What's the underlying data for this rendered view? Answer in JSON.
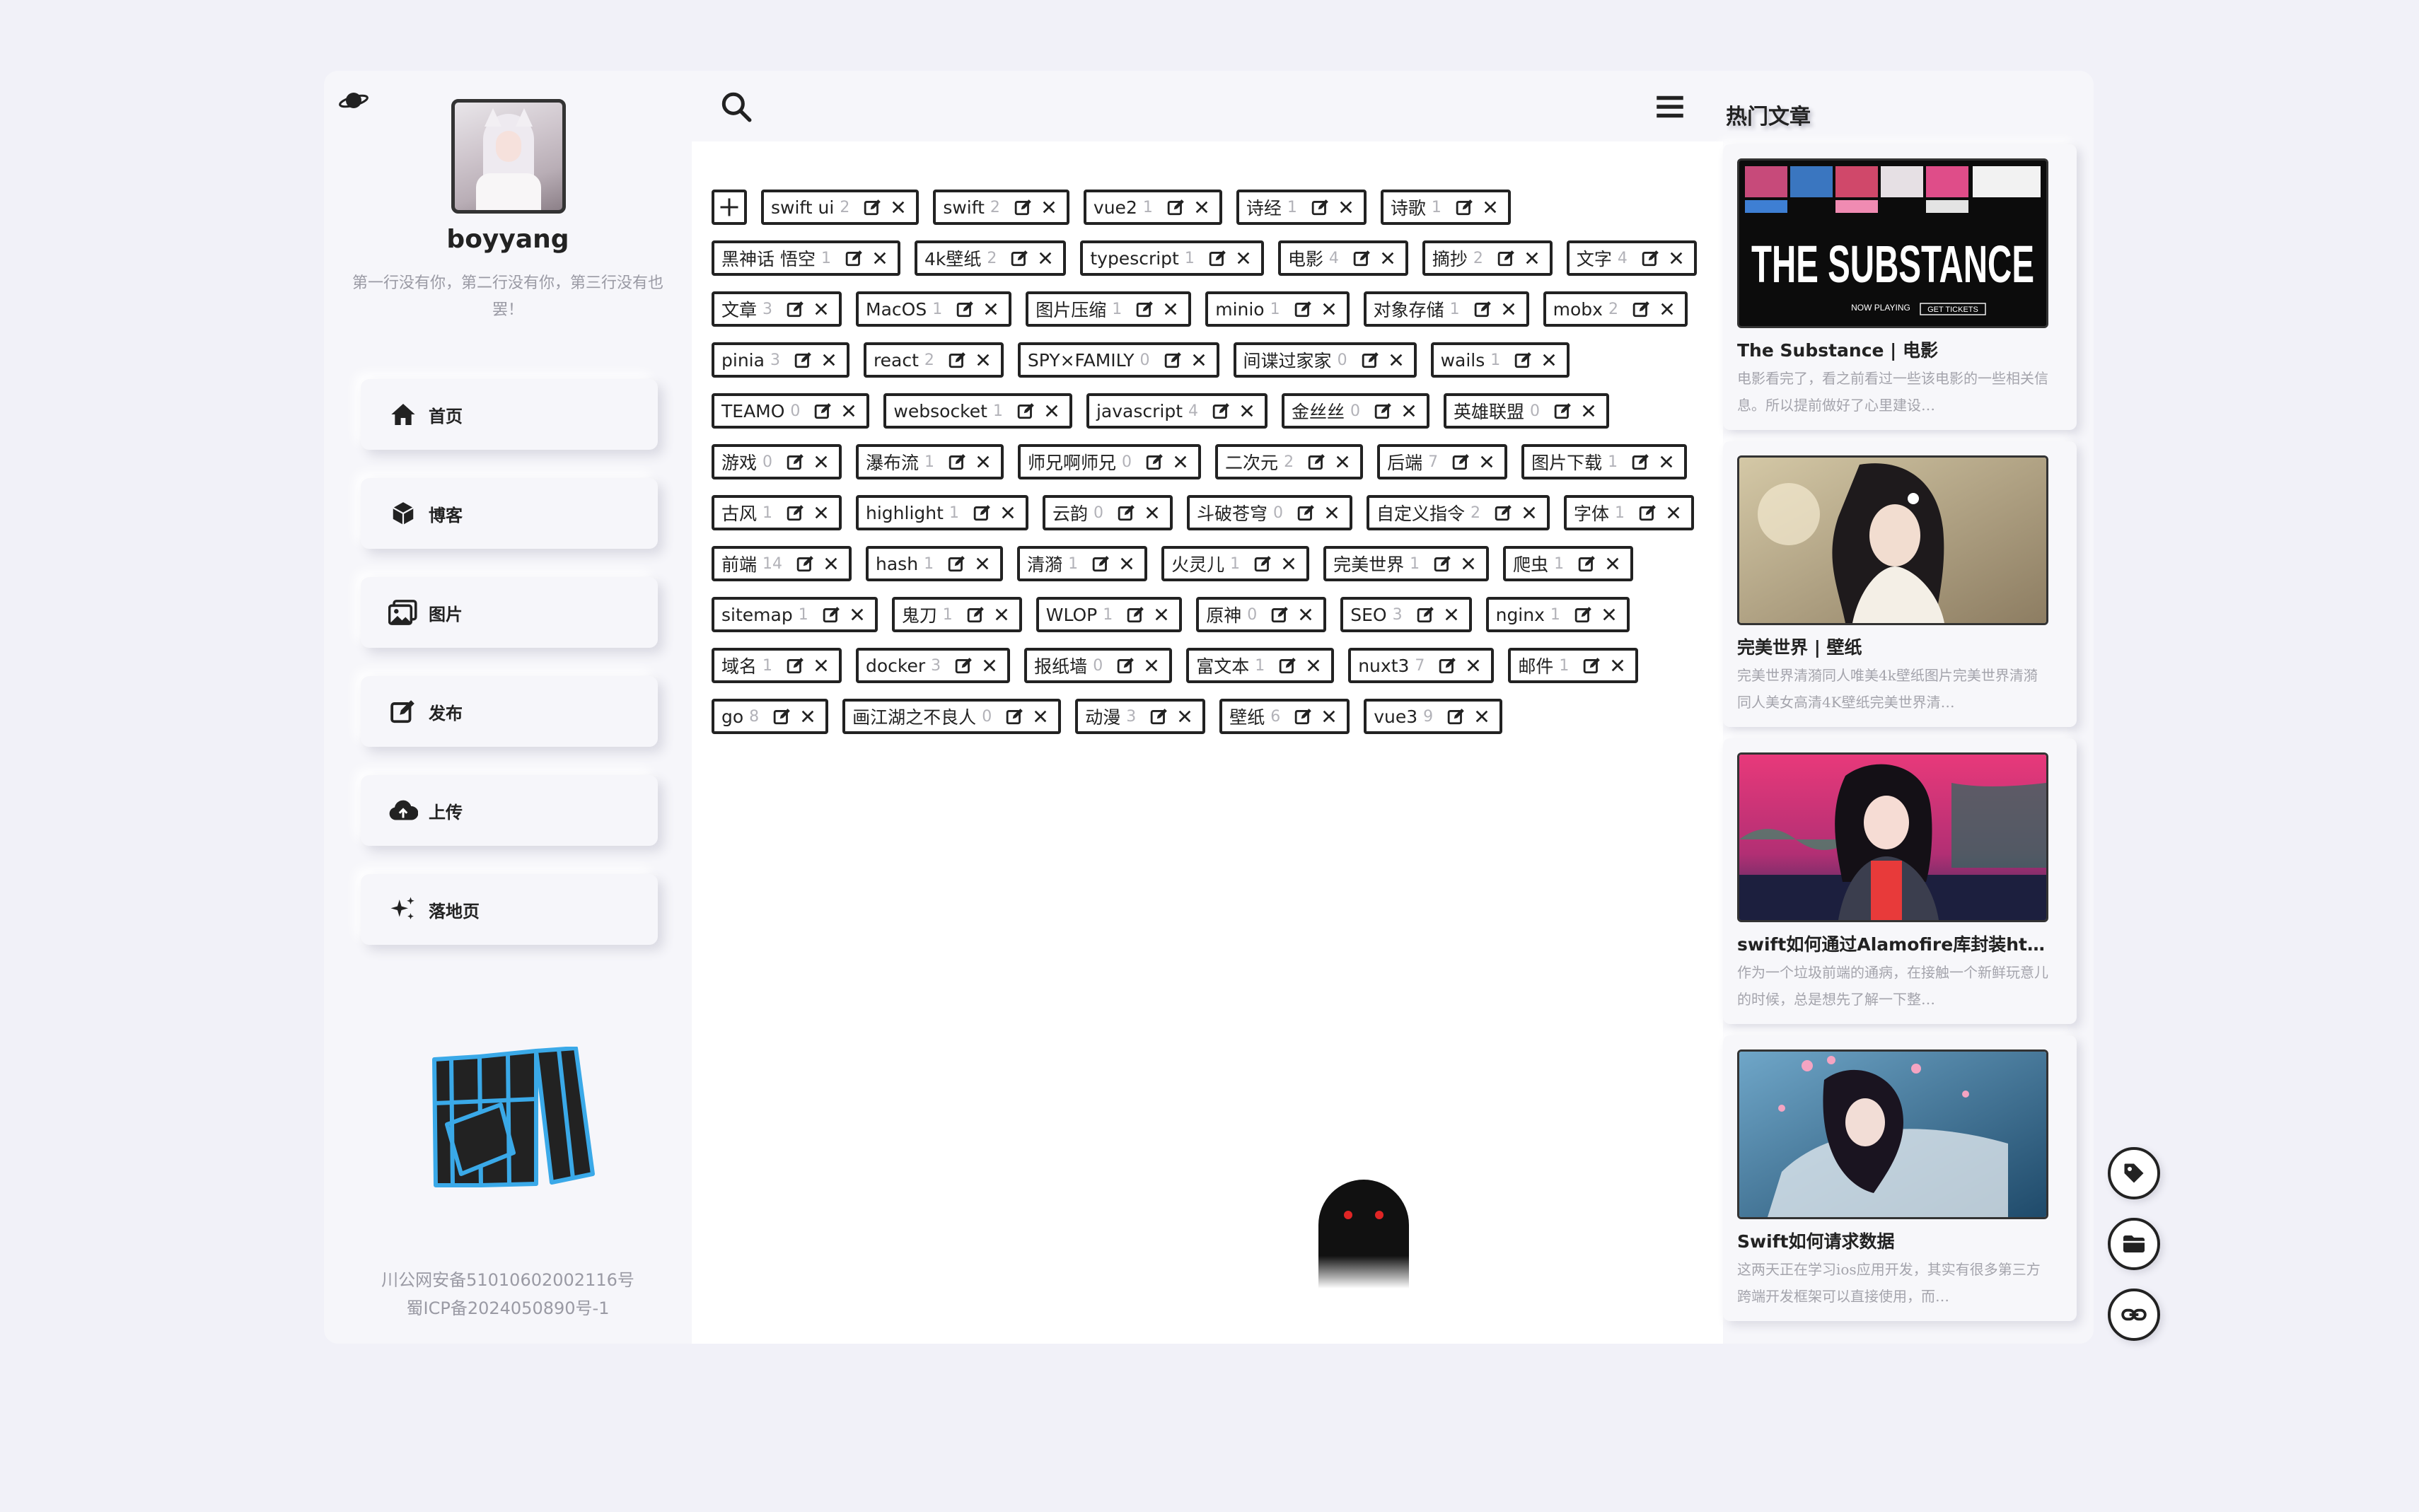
{
  "sidebar": {
    "username": "boyyang",
    "bio": "第一行没有你，第二行没有你，第三行没有也罢！",
    "nav": [
      {
        "label": "首页",
        "icon": "home-icon"
      },
      {
        "label": "博客",
        "icon": "cube-icon"
      },
      {
        "label": "图片",
        "icon": "images-icon"
      },
      {
        "label": "发布",
        "icon": "edit-icon"
      },
      {
        "label": "上传",
        "icon": "cloud-upload-icon"
      },
      {
        "label": "落地页",
        "icon": "sparkles-icon"
      }
    ],
    "footer_line1": "川公网安备51010602002116号",
    "footer_line2": "蜀ICP备2024050890号-1"
  },
  "tags": [
    {
      "name": "swift ui",
      "count": "2"
    },
    {
      "name": "swift",
      "count": "2"
    },
    {
      "name": "vue2",
      "count": "1"
    },
    {
      "name": "诗经",
      "count": "1"
    },
    {
      "name": "诗歌",
      "count": "1"
    },
    {
      "name": "黑神话 悟空",
      "count": "1"
    },
    {
      "name": "4k壁纸",
      "count": "2"
    },
    {
      "name": "typescript",
      "count": "1"
    },
    {
      "name": "电影",
      "count": "4"
    },
    {
      "name": "摘抄",
      "count": "2"
    },
    {
      "name": "文字",
      "count": "4"
    },
    {
      "name": "文章",
      "count": "3"
    },
    {
      "name": "MacOS",
      "count": "1"
    },
    {
      "name": "图片压缩",
      "count": "1"
    },
    {
      "name": "minio",
      "count": "1"
    },
    {
      "name": "对象存储",
      "count": "1"
    },
    {
      "name": "mobx",
      "count": "2"
    },
    {
      "name": "pinia",
      "count": "3"
    },
    {
      "name": "react",
      "count": "2"
    },
    {
      "name": "SPY×FAMILY",
      "count": "0"
    },
    {
      "name": "间谍过家家",
      "count": "0"
    },
    {
      "name": "wails",
      "count": "1"
    },
    {
      "name": "TEAMO",
      "count": "0"
    },
    {
      "name": "websocket",
      "count": "1"
    },
    {
      "name": "javascript",
      "count": "4"
    },
    {
      "name": "金丝丝",
      "count": "0"
    },
    {
      "name": "英雄联盟",
      "count": "0"
    },
    {
      "name": "游戏",
      "count": "0"
    },
    {
      "name": "瀑布流",
      "count": "1"
    },
    {
      "name": "师兄啊师兄",
      "count": "0"
    },
    {
      "name": "二次元",
      "count": "2"
    },
    {
      "name": "后端",
      "count": "7"
    },
    {
      "name": "图片下载",
      "count": "1"
    },
    {
      "name": "古风",
      "count": "1"
    },
    {
      "name": "highlight",
      "count": "1"
    },
    {
      "name": "云韵",
      "count": "0"
    },
    {
      "name": "斗破苍穹",
      "count": "0"
    },
    {
      "name": "自定义指令",
      "count": "2"
    },
    {
      "name": "字体",
      "count": "1"
    },
    {
      "name": "前端",
      "count": "14"
    },
    {
      "name": "hash",
      "count": "1"
    },
    {
      "name": "清漪",
      "count": "1"
    },
    {
      "name": "火灵儿",
      "count": "1"
    },
    {
      "name": "完美世界",
      "count": "1"
    },
    {
      "name": "爬虫",
      "count": "1"
    },
    {
      "name": "sitemap",
      "count": "1"
    },
    {
      "name": "鬼刀",
      "count": "1"
    },
    {
      "name": "WLOP",
      "count": "1"
    },
    {
      "name": "原神",
      "count": "0"
    },
    {
      "name": "SEO",
      "count": "3"
    },
    {
      "name": "nginx",
      "count": "1"
    },
    {
      "name": "域名",
      "count": "1"
    },
    {
      "name": "docker",
      "count": "3"
    },
    {
      "name": "报纸墙",
      "count": "0"
    },
    {
      "name": "富文本",
      "count": "1"
    },
    {
      "name": "nuxt3",
      "count": "7"
    },
    {
      "name": "邮件",
      "count": "1"
    },
    {
      "name": "go",
      "count": "8"
    },
    {
      "name": "画江湖之不良人",
      "count": "0"
    },
    {
      "name": "动漫",
      "count": "3"
    },
    {
      "name": "壁纸",
      "count": "6"
    },
    {
      "name": "vue3",
      "count": "9"
    }
  ],
  "hot": {
    "title": "热门文章",
    "posts": [
      {
        "title": "The Substance | 电影",
        "desc": "电影看完了，看之前看过一些该电影的一些相关信息。所以提前做好了心里建设…",
        "thumb_text": "THE SUBSTANCE",
        "thumb_small": "NOW PLAYING",
        "thumb_btn": "GET TICKETS"
      },
      {
        "title": "完美世界 | 壁纸",
        "desc": "完美世界清漪同人唯美4k壁纸图片完美世界清漪同人美女高清4K壁纸完美世界清…"
      },
      {
        "title": "swift如何通过Alamofire库封装ht…",
        "desc": "作为一个垃圾前端的通病，在接触一个新鲜玩意儿的时候，总是想先了解一下整…"
      },
      {
        "title": "Swift如何请求数据",
        "desc": "这两天正在学习ios应用开发，其实有很多第三方跨端开发框架可以直接使用，而…"
      }
    ]
  },
  "colors": {
    "accent": "#222222",
    "muted": "#9a9aa4",
    "logo_blue": "#3aa9e8"
  }
}
